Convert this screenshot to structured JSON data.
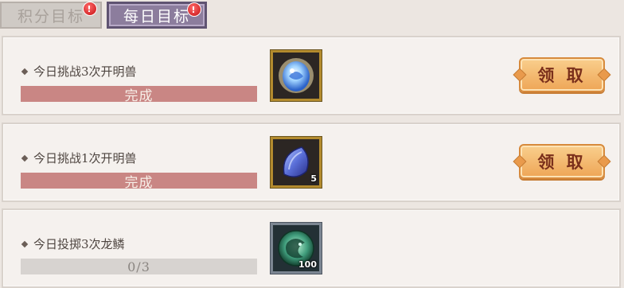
{
  "tabs": [
    {
      "label": "积分目标",
      "active": false,
      "badge": "!"
    },
    {
      "label": "每日目标",
      "active": true,
      "badge": "!"
    }
  ],
  "tasks": [
    {
      "title": "今日挑战3次开明兽",
      "progress_text": "完成",
      "progress": 1.0,
      "reward_icon": "blue-crystal-orb-icon",
      "reward_qty": "",
      "claim_label": "领 取"
    },
    {
      "title": "今日挑战1次开明兽",
      "progress_text": "完成",
      "progress": 1.0,
      "reward_icon": "blue-scale-gem-icon",
      "reward_qty": "5",
      "claim_label": "领 取"
    },
    {
      "title": "今日投掷3次龙鳞",
      "progress_text": "0/3",
      "progress": 0.0,
      "reward_icon": "jade-dragon-token-icon",
      "reward_qty": "100",
      "claim_label": ""
    }
  ],
  "colors": {
    "progress_fill": "#c98684",
    "claim_button": "#f0ab5e",
    "active_tab": "#8c7d9d"
  }
}
